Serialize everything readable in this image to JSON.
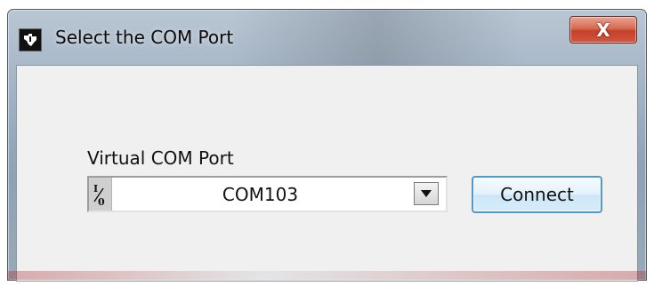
{
  "window": {
    "title": "Select the COM Port",
    "close_label": "X",
    "app_icon": "ti-logo-icon"
  },
  "form": {
    "port_label": "Virtual COM Port",
    "port_selected": "COM103",
    "port_icon": "io-icon",
    "dropdown_icon": "chevron-down-icon",
    "connect_label": "Connect"
  },
  "colors": {
    "accent_button_border": "#4f9ac9",
    "close_button_red": "#c4402a",
    "client_background": "#f0f0f0"
  }
}
